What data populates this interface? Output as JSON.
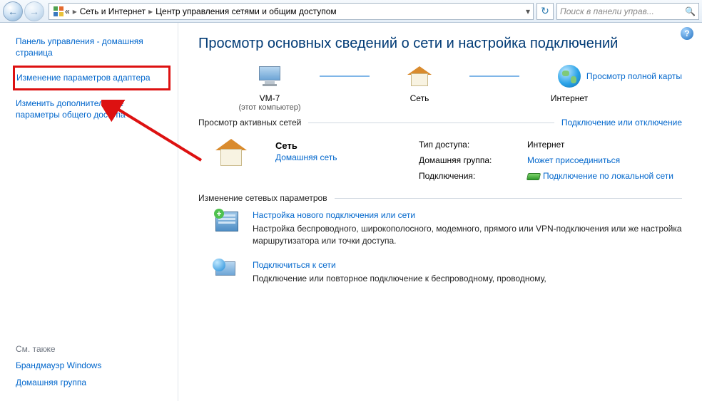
{
  "nav": {
    "back_tooltip": "Назад",
    "fwd_tooltip": "Вперёд",
    "ellipsis": "«",
    "crumb1": "Сеть и Интернет",
    "crumb2": "Центр управления сетями и общим доступом",
    "refresh_tooltip": "Обновить",
    "search_placeholder": "Поиск в панели управ..."
  },
  "sidebar": {
    "home": "Панель управления - домашняя страница",
    "adapter": "Изменение параметров адаптера",
    "sharing": "Изменить дополнительные параметры общего доступа",
    "seealso_title": "См. также",
    "firewall": "Брандмауэр Windows",
    "homegroup": "Домашняя группа"
  },
  "main": {
    "title": "Просмотр основных сведений о сети и настройка подключений",
    "full_map": "Просмотр полной карты",
    "map": {
      "this_pc": "VM-7",
      "this_pc_sub": "(этот компьютер)",
      "network": "Сеть",
      "internet": "Интернет"
    },
    "section_active": "Просмотр активных сетей",
    "connect_disconnect": "Подключение или отключение",
    "active": {
      "name": "Сеть",
      "type": "Домашняя сеть",
      "access_label": "Тип доступа:",
      "access_value": "Интернет",
      "homegroup_label": "Домашняя группа:",
      "homegroup_value": "Может присоединиться",
      "conn_label": "Подключения:",
      "conn_value": "Подключение по локальной сети"
    },
    "section_change": "Изменение сетевых параметров",
    "items": {
      "new_conn_title": "Настройка нового подключения или сети",
      "new_conn_desc": "Настройка беспроводного, широкополосного, модемного, прямого или VPN-подключения или же настройка маршрутизатора или точки доступа.",
      "connect_title": "Подключиться к сети",
      "connect_desc": "Подключение или повторное подключение к беспроводному, проводному,"
    }
  }
}
